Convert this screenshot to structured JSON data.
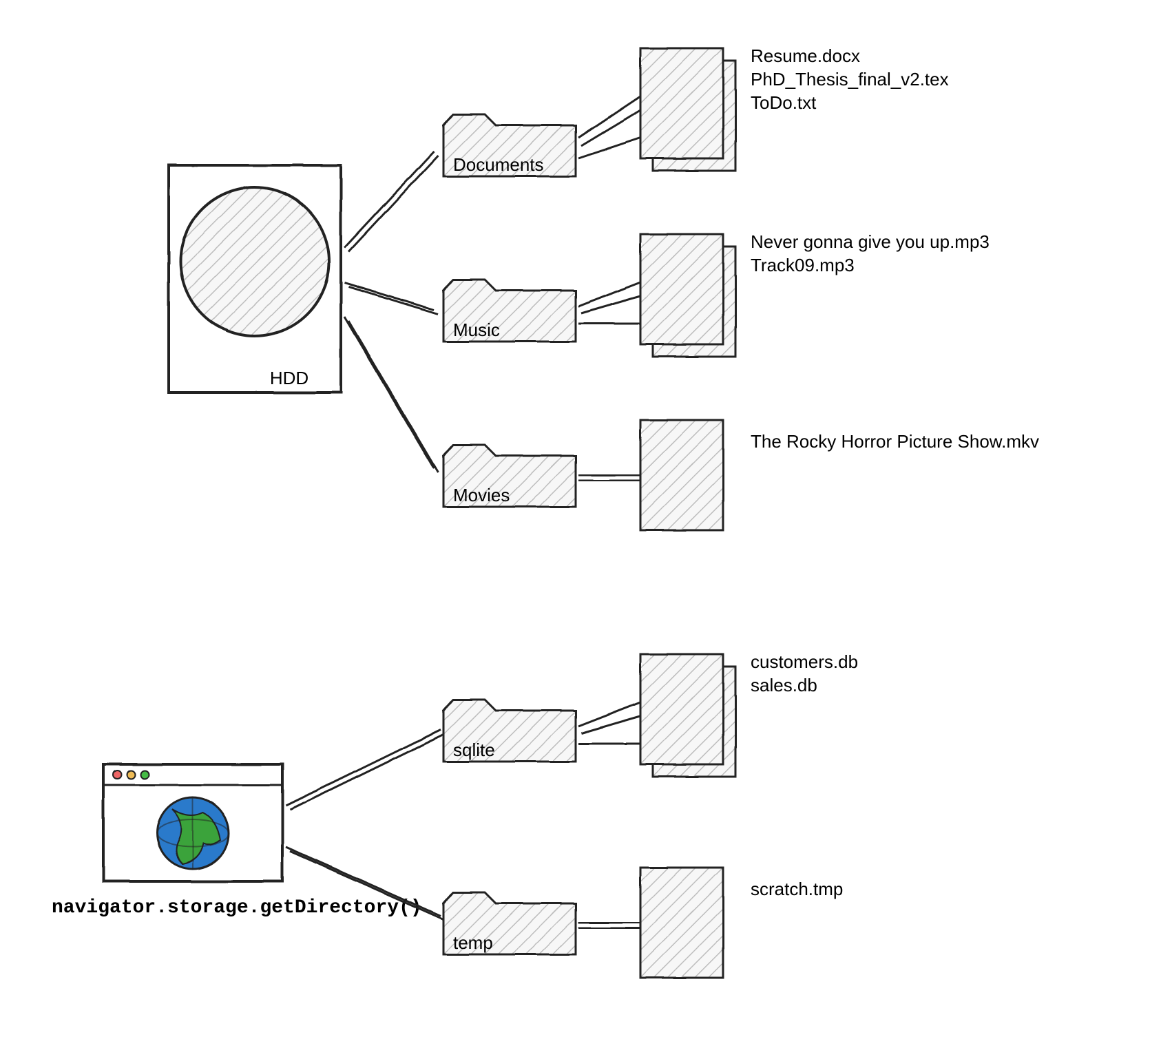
{
  "hdd": {
    "label": "HDD",
    "folders": [
      {
        "name": "Documents",
        "files": [
          "Resume.docx",
          "PhD_Thesis_final_v2.tex",
          "ToDo.txt"
        ]
      },
      {
        "name": "Music",
        "files": [
          "Never gonna give you up.mp3",
          "Track09.mp3"
        ]
      },
      {
        "name": "Movies",
        "files": [
          "The Rocky Horror Picture Show.mkv"
        ]
      }
    ]
  },
  "browser": {
    "api_label": "navigator.storage.getDirectory()",
    "folders": [
      {
        "name": "sqlite",
        "files": [
          "customers.db",
          "sales.db"
        ]
      },
      {
        "name": "temp",
        "files": [
          "scratch.tmp"
        ]
      }
    ]
  }
}
